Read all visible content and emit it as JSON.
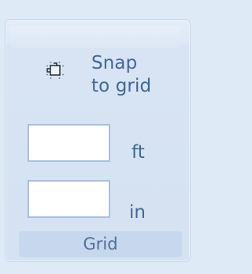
{
  "ribbon_group": {
    "name": "Grid",
    "snap_button": {
      "icon": "snap-to-grid-icon",
      "label_line1": "Snap",
      "label_line2": "to grid"
    },
    "fields": [
      {
        "value": "",
        "unit": "ft"
      },
      {
        "value": "",
        "unit": "in"
      }
    ]
  },
  "colors": {
    "background": "#dfeaf7",
    "border": "#c3d5ec",
    "text": "#40679a",
    "input_border": "#a9c0df",
    "label_bar": "#c7d8ee"
  }
}
